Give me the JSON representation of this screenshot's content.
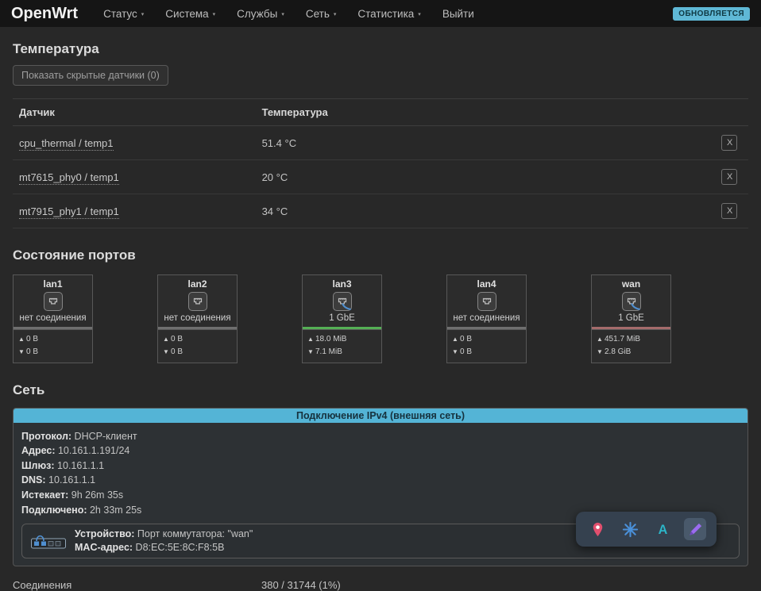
{
  "glyphs": {
    "caret": "▾",
    "up": "▲",
    "down": "▼",
    "remove": "X"
  },
  "navbar": {
    "brand": "OpenWrt",
    "items": [
      {
        "label": "Статус"
      },
      {
        "label": "Система"
      },
      {
        "label": "Службы"
      },
      {
        "label": "Сеть"
      },
      {
        "label": "Статистика"
      },
      {
        "label": "Выйти"
      }
    ],
    "badge": "ОБНОВЛЯЕТСЯ"
  },
  "temperature": {
    "title": "Температура",
    "show_hidden_button": "Показать скрытые датчики (0)",
    "headers": [
      "Датчик",
      "Температура"
    ],
    "rows": [
      {
        "sensor": "cpu_thermal / temp1",
        "value": "51.4 °C"
      },
      {
        "sensor": "mt7615_phy0 / temp1",
        "value": "20 °C"
      },
      {
        "sensor": "mt7915_phy1 / temp1",
        "value": "34 °C"
      }
    ]
  },
  "ports": {
    "title": "Состояние портов",
    "items": [
      {
        "name": "lan1",
        "status": "нет соединения",
        "connected": false,
        "bar_color": "#6f6f6f",
        "up": "0 B",
        "down": "0 B"
      },
      {
        "name": "lan2",
        "status": "нет соединения",
        "connected": false,
        "bar_color": "#6f6f6f",
        "up": "0 B",
        "down": "0 B"
      },
      {
        "name": "lan3",
        "status": "1 GbE",
        "connected": true,
        "bar_color": "#55b055",
        "up": "18.0 MiB",
        "down": "7.1 MiB"
      },
      {
        "name": "lan4",
        "status": "нет соединения",
        "connected": false,
        "bar_color": "#6f6f6f",
        "up": "0 B",
        "down": "0 B"
      },
      {
        "name": "wan",
        "status": "1 GbE",
        "connected": true,
        "bar_color": "#a56b6b",
        "up": "451.7 MiB",
        "down": "2.8 GiB"
      }
    ]
  },
  "network": {
    "title": "Сеть",
    "ipv4_header": "Подключение IPv4 (внешняя сеть)",
    "fields": [
      {
        "label": "Протокол:",
        "value": "DHCP-клиент"
      },
      {
        "label": "Адрес:",
        "value": "10.161.1.191/24"
      },
      {
        "label": "Шлюз:",
        "value": "10.161.1.1"
      },
      {
        "label": "DNS:",
        "value": "10.161.1.1"
      },
      {
        "label": "Истекает:",
        "value": "9h 26m 35s"
      },
      {
        "label": "Подключено:",
        "value": "2h 33m 25s"
      }
    ],
    "device": {
      "label": "Устройство:",
      "value": "Порт коммутатора: \"wan\"",
      "mac_label": "MAC-адрес:",
      "mac_value": "D8:EC:5E:8C:F8:5B"
    },
    "connections_label": "Соединения",
    "connections_value": "380 / 31744 (1%)"
  },
  "overlay": {
    "letter": "A"
  },
  "colors": {
    "accent_cyan": "#54b4d6",
    "link_up_green": "#55b055",
    "link_up_red": "#a56b6b",
    "no_link_gray": "#6f6f6f"
  }
}
